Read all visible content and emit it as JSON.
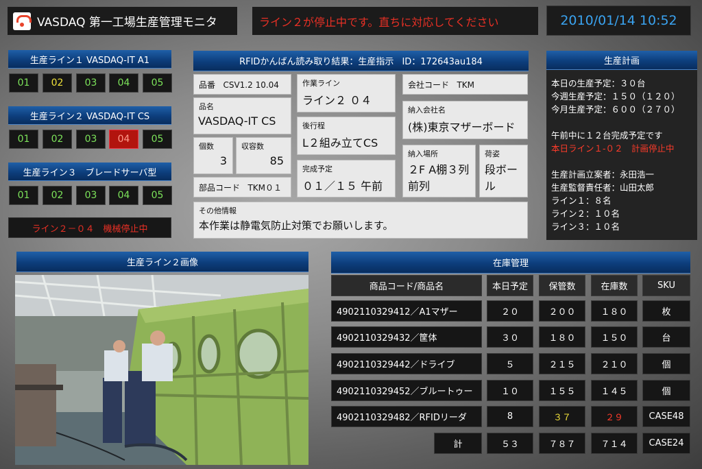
{
  "header": {
    "title": "VASDAQ 第一工場生産管理モニタ",
    "alert": "ライン２が停止中です。直ちに対応してください",
    "datetime": "2010/01/14 10:52"
  },
  "lines": [
    {
      "title": "生産ライン１ VASDAQ-IT A1",
      "cells": [
        {
          "label": "01",
          "status": "green"
        },
        {
          "label": "02",
          "status": "yellow"
        },
        {
          "label": "03",
          "status": "green"
        },
        {
          "label": "04",
          "status": "green"
        },
        {
          "label": "05",
          "status": "green"
        }
      ]
    },
    {
      "title": "生産ライン２ VASDAQ-IT CS",
      "cells": [
        {
          "label": "01",
          "status": "green"
        },
        {
          "label": "02",
          "status": "green"
        },
        {
          "label": "03",
          "status": "green"
        },
        {
          "label": "04",
          "status": "red"
        },
        {
          "label": "05",
          "status": "green"
        }
      ]
    },
    {
      "title": "生産ライン３　ブレードサーバ型",
      "cells": [
        {
          "label": "01",
          "status": "green"
        },
        {
          "label": "02",
          "status": "green"
        },
        {
          "label": "03",
          "status": "green"
        },
        {
          "label": "04",
          "status": "green"
        },
        {
          "label": "05",
          "status": "green"
        }
      ]
    }
  ],
  "line_alert": "ライン２－０４　機械停止中",
  "rfid": {
    "title_prefix": "RFIDかんばん読み取り結果：",
    "title_bold": "生産指示",
    "title_id": "ID：172643au184",
    "part_no": {
      "label": "品番",
      "value": "CSV1.2 10.04"
    },
    "product_name": {
      "label": "品名",
      "value": "VASDAQ-IT CS"
    },
    "quantity": {
      "label": "個数",
      "value": "3"
    },
    "capacity": {
      "label": "収容数",
      "value": "85"
    },
    "parts_code": {
      "label": "部品コード",
      "value": "TKM０１"
    },
    "work_line": {
      "label": "作業ライン",
      "value": "ライン２ ０４"
    },
    "next_process": {
      "label": "後行程",
      "value": "L２組み立てCS"
    },
    "completion": {
      "label": "完成予定",
      "value": "０１／１５ 午前"
    },
    "company_code": {
      "label": "会社コード",
      "value": "TKM"
    },
    "delivery_company": {
      "label": "納入会社名",
      "value": "(株)東京マザーボード"
    },
    "delivery_place": {
      "label": "納入場所",
      "value1": "２F A棚３列",
      "value2": "前列"
    },
    "packing": {
      "label": "荷姿",
      "value1": "段ボー",
      "value2": "ル"
    },
    "other": {
      "label": "その他情報",
      "value": "本作業は静電気防止対策でお願いします。"
    }
  },
  "plan": {
    "title": "生産計画",
    "lines": [
      {
        "text": "本日の生産予定：３０台",
        "color": "white"
      },
      {
        "text": "今週生産予定：１５０（１２０）",
        "color": "white"
      },
      {
        "text": "今月生産予定：６００（２７０）",
        "color": "white"
      },
      {
        "text": "",
        "color": "white"
      },
      {
        "text": "午前中に１２台完成予定です",
        "color": "white"
      },
      {
        "text": "本日ライン１-０２　計画停止中",
        "color": "red"
      },
      {
        "text": "",
        "color": "white"
      },
      {
        "text": "生産計画立案者：永田浩一",
        "color": "white"
      },
      {
        "text": "生産監督責任者：山田太郎",
        "color": "white"
      },
      {
        "text": "ライン１：８名",
        "color": "white"
      },
      {
        "text": "ライン２：１０名",
        "color": "white"
      },
      {
        "text": "ライン３：１０名",
        "color": "white"
      }
    ]
  },
  "image_panel": {
    "title": "生産ライン２画像"
  },
  "inventory": {
    "title": "在庫管理",
    "headers": [
      "商品コード/商品名",
      "本日予定",
      "保管数",
      "在庫数",
      "SKU"
    ],
    "rows": [
      {
        "name": "4902110329412／A1マザー",
        "today": "２０",
        "stored": "２００",
        "stock": "１８０",
        "sku": "枚",
        "stored_color": "white",
        "stock_color": "white"
      },
      {
        "name": "4902110329432／筐体",
        "today": "３０",
        "stored": "１８０",
        "stock": "１５０",
        "sku": "台",
        "stored_color": "white",
        "stock_color": "white"
      },
      {
        "name": "4902110329442／ドライブ",
        "today": "５",
        "stored": "２１５",
        "stock": "２１０",
        "sku": "個",
        "stored_color": "white",
        "stock_color": "white"
      },
      {
        "name": "4902110329452／ブルートゥー",
        "today": "１０",
        "stored": "１５５",
        "stock": "１４５",
        "sku": "個",
        "stored_color": "white",
        "stock_color": "white"
      },
      {
        "name": "4902110329482／RFIDリーダ",
        "today": "8",
        "stored": "３７",
        "stock": "２９",
        "sku": "CASE48",
        "stored_color": "yellow",
        "stock_color": "red"
      }
    ],
    "total": {
      "label": "計",
      "today": "５３",
      "stored": "７８７",
      "stock": "７１４",
      "sku": "CASE24"
    }
  }
}
